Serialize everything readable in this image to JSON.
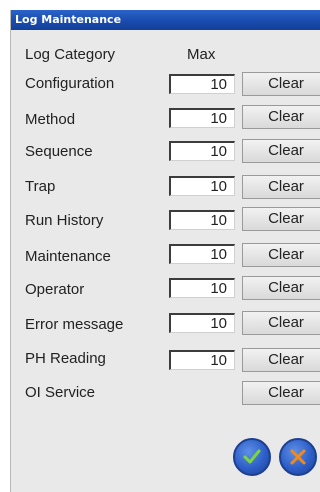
{
  "window": {
    "title": "Log Maintenance"
  },
  "headers": {
    "category": "Log Category",
    "max": "Max"
  },
  "rows": [
    {
      "label": "Configuration",
      "max": "10",
      "button": "Clear"
    },
    {
      "label": "Method",
      "max": "10",
      "button": "Clear"
    },
    {
      "label": "Sequence",
      "max": "10",
      "button": "Clear"
    },
    {
      "label": "Trap",
      "max": "10",
      "button": "Clear"
    },
    {
      "label": "Run History",
      "max": "10",
      "button": "Clear"
    },
    {
      "label": "Maintenance",
      "max": "10",
      "button": "Clear"
    },
    {
      "label": "Operator",
      "max": "10",
      "button": "Clear"
    },
    {
      "label": "Error message",
      "max": "10",
      "button": "Clear"
    },
    {
      "label": "PH Reading",
      "max": "10",
      "button": "Clear"
    },
    {
      "label": "OI Service",
      "button": "Clear"
    }
  ],
  "icons": {
    "ok": "checkmark-icon",
    "cancel": "x-icon"
  },
  "colors": {
    "titlebar": "#1a4cae",
    "check": "#7dd63a",
    "cross": "#f08a1a"
  }
}
